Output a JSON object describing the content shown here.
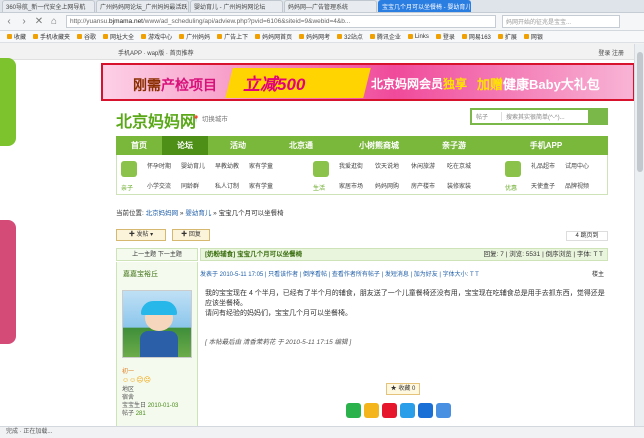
{
  "browser": {
    "tabs": [
      {
        "label": "360导航_新一代安全上网导航",
        "active": false
      },
      {
        "label": "广州妈妈网论坛_广州妈妈最活跃...",
        "active": false
      },
      {
        "label": "婴幼育儿 - 广州妈妈网论坛",
        "active": false
      },
      {
        "label": "妈妈网—广告管理系统",
        "active": false
      },
      {
        "label": "宝宝几个月可以坐餐椅 - 婴幼育儿",
        "active": true
      }
    ],
    "url_prefix": "http://yuansu.",
    "url_host": "bjmama.net",
    "url_path": "/www/ad_scheduling/api/adview.php?pvid=6106&siteid=9&webid=4&b...",
    "search_placeholder": "妈网开始的征兆是宝宝...",
    "bookmarks": [
      "收藏",
      "手机收藏夹",
      "谷歌",
      "网址大全",
      "游戏中心",
      "广州妈妈",
      "广告上下",
      "妈妈网首页",
      "妈妈网考",
      "32站点",
      "腾讯企业",
      "Links",
      "登录",
      "网易163",
      "扩展",
      "网银"
    ]
  },
  "site": {
    "topbar_left": "手机APP  ·  wap版  ·  首页推荐",
    "topbar_right": "登录  注册",
    "banner": {
      "part1a": "刚需",
      "part1b": "产检项目",
      "part2": "立减500",
      "part3a": "北京妈网会员",
      "part3b": "独享",
      "part4a": "加赠",
      "part4b": "健康Baby大礼包"
    },
    "logo": "北京妈妈网",
    "location": "切换城市",
    "search_select": "帖子",
    "search_placeholder": "搜索其实很简单(^-^)...",
    "nav": [
      "首页",
      "论坛",
      "活动",
      "北京通",
      "小树熊商城",
      "亲子游",
      "手机APP"
    ],
    "subnav": [
      {
        "label": "亲子",
        "links": [
          "怀孕时期",
          "婴幼育儿",
          "早教幼教",
          "家有学童",
          "小学交流",
          "同龄群",
          "私人订制",
          "家有学童"
        ]
      },
      {
        "label": "生活",
        "links": [
          "我爱逛街",
          "饮天说地",
          "休闲旅游",
          "吃在京城",
          "家居市场",
          "妈妈网购",
          "房产楼市",
          "装修家装"
        ]
      },
      {
        "label": "优惠",
        "links": [
          "礼品超市",
          "试用中心",
          "天使盒子",
          "品牌视频"
        ]
      }
    ],
    "breadcrumb_prefix": "当前位置:",
    "breadcrumb_home": "北京妈妈网",
    "breadcrumb_board": "婴幼育儿",
    "breadcrumb_title": "宝宝几个月可以坐餐椅"
  },
  "thread": {
    "reply_btn": "发帖",
    "reply_btn2": "回复",
    "replies_badge": "4 跳页到",
    "prevnext": "上一主题  下一主题",
    "title": "[奶粉辅食] 宝宝几个月可以坐餐椅",
    "stats": "回复: 7 | 浏览: 5531 | 倒序浏览 | 字体: T  T",
    "author": "嘉嘉宝裕丘",
    "level": "初一",
    "stars": "☺☺☹☹",
    "info": [
      {
        "k": "地区",
        "v": ""
      },
      {
        "k": "宿舍",
        "v": ""
      },
      {
        "k": "宝宝生日",
        "v": "2010-01-03"
      },
      {
        "k": "帖子",
        "v": "281"
      }
    ],
    "postbar": "发表于 2010-5-11 17:05  |  只看该作者  |  倒序看帖  |  查看作者所有帖子  |  发短消息  |  加为好友  |  字体大小: T  T",
    "floor": "楼主",
    "body1": "我的宝宝现在 4 个半月，已经有了半个月的辅食，朋友送了一个儿童餐椅还没有用，宝宝现在吃辅食总是用手去抓东西，觉得还是应该坐餐椅。",
    "body2": "请问有经验的妈妈们，宝宝几个月可以坐餐椅。",
    "edited": "[ 本帖最后由 清香茉莉花 于 2010-5-11 17:15 编辑 ]",
    "fav": "收藏 0"
  },
  "statusbar": "完成  ·  正在加载..."
}
